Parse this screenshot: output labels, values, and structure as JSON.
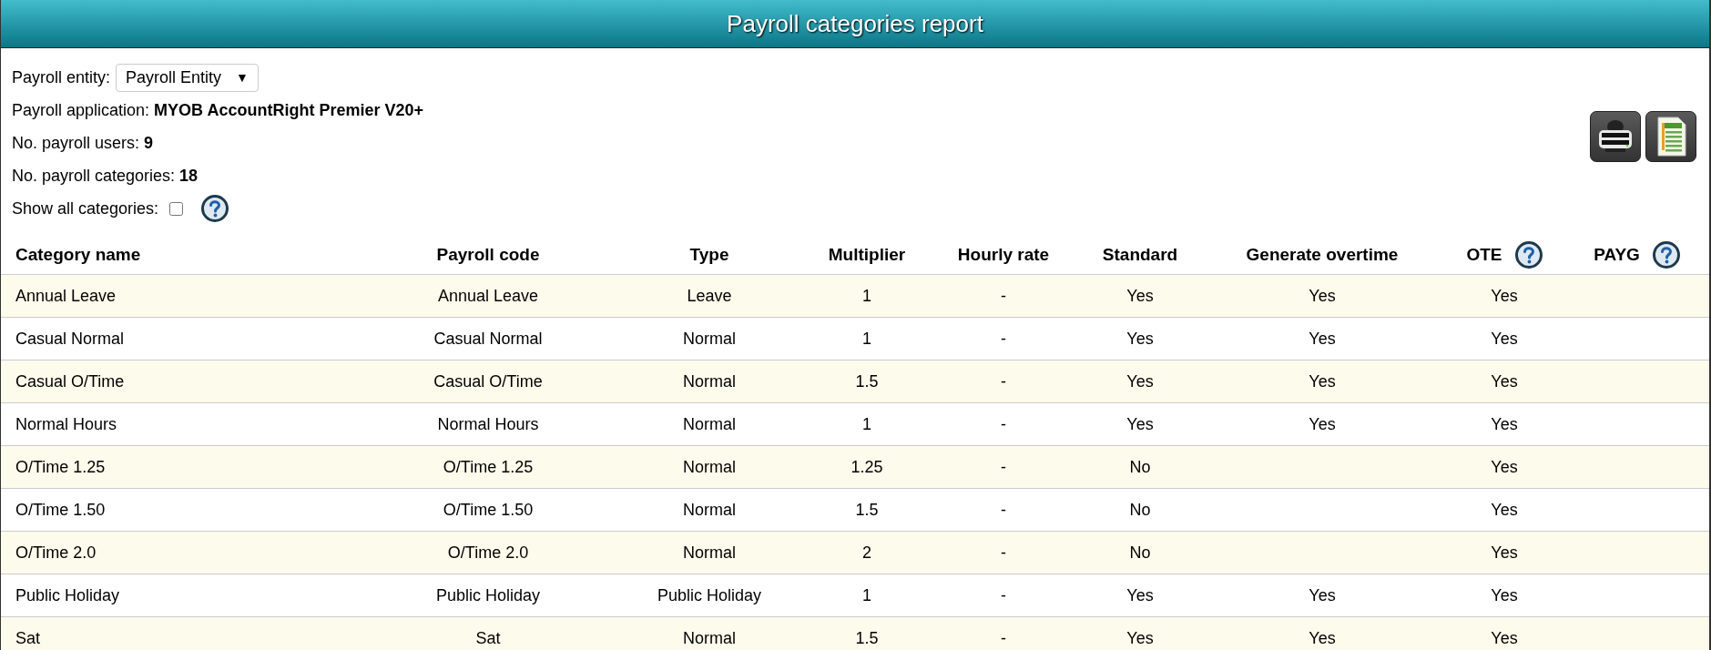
{
  "window": {
    "title": "Payroll categories report"
  },
  "entity": {
    "label": "Payroll entity:",
    "value": "Payroll Entity",
    "caret": "▼"
  },
  "info": [
    {
      "label": "Payroll application:",
      "value": "MYOB AccountRight Premier V20+"
    },
    {
      "label": "No. payroll users:",
      "value": "9"
    },
    {
      "label": "No. payroll categories:",
      "value": "18"
    }
  ],
  "show_all": {
    "label": "Show all categories:",
    "checked": false
  },
  "table": {
    "columns": [
      {
        "label": "Category name",
        "kind": "plain"
      },
      {
        "label": "Payroll code",
        "kind": "plain"
      },
      {
        "label": "Type",
        "kind": "plain"
      },
      {
        "label": "Multiplier",
        "kind": "plain"
      },
      {
        "label": "Hourly rate",
        "kind": "plain"
      },
      {
        "label": "Standard",
        "kind": "plain"
      },
      {
        "label": "Generate overtime",
        "kind": "plain"
      },
      {
        "label": "OTE",
        "kind": "help"
      },
      {
        "label": "PAYG",
        "kind": "help"
      }
    ],
    "rows": [
      {
        "cells": [
          "Annual Leave",
          "Annual Leave",
          "Leave",
          "1",
          "-",
          "Yes",
          "Yes",
          "Yes"
        ]
      },
      {
        "cells": [
          "Casual Normal",
          "Casual Normal",
          "Normal",
          "1",
          "-",
          "Yes",
          "Yes",
          "Yes"
        ]
      },
      {
        "cells": [
          "Casual O/Time",
          "Casual O/Time",
          "Normal",
          "1.5",
          "-",
          "Yes",
          "Yes",
          "Yes"
        ]
      },
      {
        "cells": [
          "Normal Hours",
          "Normal Hours",
          "Normal",
          "1",
          "-",
          "Yes",
          "Yes",
          "Yes"
        ]
      },
      {
        "cells": [
          "O/Time 1.25",
          "O/Time 1.25",
          "Normal",
          "1.25",
          "-",
          "No",
          null,
          "Yes"
        ]
      },
      {
        "cells": [
          "O/Time 1.50",
          "O/Time 1.50",
          "Normal",
          "1.5",
          "-",
          "No",
          null,
          "Yes"
        ]
      },
      {
        "cells": [
          "O/Time 2.0",
          "O/Time 2.0",
          "Normal",
          "2",
          "-",
          "No",
          null,
          "Yes"
        ]
      },
      {
        "cells": [
          "Public Holiday",
          "Public Holiday",
          "Public Holiday",
          "1",
          "-",
          "Yes",
          "Yes",
          "Yes"
        ]
      },
      {
        "cells": [
          "Sat",
          "Sat",
          "Normal",
          "1.5",
          "-",
          "Yes",
          "Yes",
          "Yes"
        ]
      }
    ]
  }
}
